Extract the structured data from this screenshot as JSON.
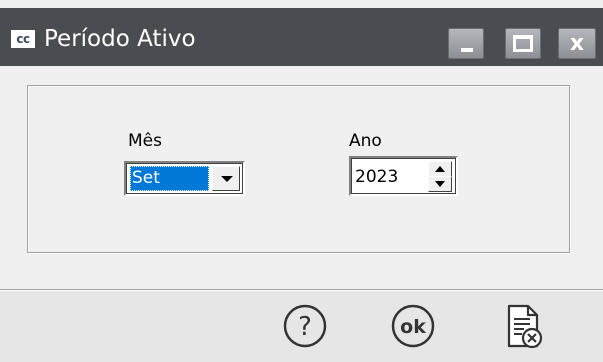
{
  "window": {
    "icon_text": "cc",
    "title": "Período Ativo",
    "controls": {
      "minimize": "minimize-icon",
      "maximize": "maximize-icon",
      "close_glyph": "x",
      "close": "close-icon"
    },
    "colors": {
      "titlebar": "#494c51",
      "selection": "#0078d7",
      "body": "#f0f0f0"
    }
  },
  "form": {
    "month": {
      "label": "Mês",
      "value": "Set"
    },
    "year": {
      "label": "Ano",
      "value": "2023"
    }
  },
  "footer": {
    "help_button": "help-icon",
    "ok_button_text": "ok",
    "cancel_button": "cancel-document-icon"
  }
}
